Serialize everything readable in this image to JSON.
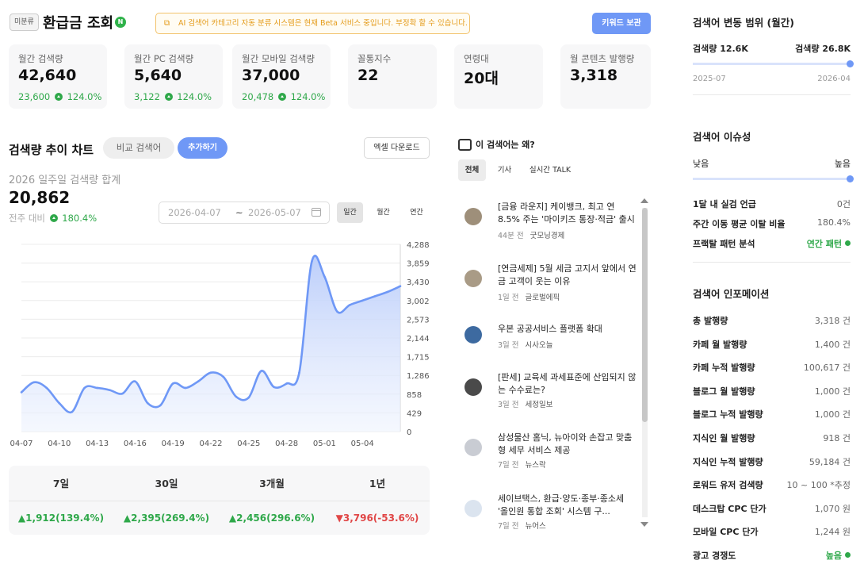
{
  "header": {
    "tag": "미분류",
    "title": "환급금 조회",
    "badge": "N",
    "beta_notice": "AI 검색어 카테고리 자동 분류 시스템은 현재 Beta 서비스 중입니다. 부정확 할 수 있습니다.",
    "save_button": "키워드 보관"
  },
  "cards": [
    {
      "label": "월간 검색량",
      "value": "42,640",
      "sub_value": "23,600",
      "sub_pct": "124.0%"
    },
    {
      "label": "월간 PC 검색량",
      "value": "5,640",
      "sub_value": "3,122",
      "sub_pct": "124.0%"
    },
    {
      "label": "월간 모바일 검색량",
      "value": "37,000",
      "sub_value": "20,478",
      "sub_pct": "124.0%"
    },
    {
      "label": "꼴통지수",
      "value": "22"
    },
    {
      "label": "연령대",
      "value": "20대"
    },
    {
      "label": "월 콘텐츠 발행량",
      "value": "3,318"
    }
  ],
  "trend": {
    "title": "검색량 추이 차트",
    "compare_button": "비교 검색어",
    "add_button": "추가하기",
    "excel_button": "엑셀 다운로드",
    "summary_label": "2026 일주일 검색량 합계",
    "summary_value": "20,862",
    "wow_label": "전주 대비",
    "wow_pct": "180.4%",
    "date_from": "2026-04-07",
    "date_sep": "~",
    "date_to": "2026-05-07",
    "periods": [
      "일간",
      "월간",
      "연간"
    ]
  },
  "chart_data": {
    "type": "area",
    "color": "#6f98f6",
    "yticks": [
      "4,288",
      "3,859",
      "3,430",
      "3,002",
      "2,573",
      "2,144",
      "1,715",
      "1,286",
      "858",
      "429",
      "0"
    ],
    "ylim": [
      0,
      4288
    ],
    "xticks": [
      "04-07",
      "04-10",
      "04-13",
      "04-16",
      "04-19",
      "04-22",
      "04-25",
      "04-28",
      "05-01",
      "05-04"
    ],
    "x": [
      "04-07",
      "04-08",
      "04-09",
      "04-10",
      "04-11",
      "04-12",
      "04-13",
      "04-14",
      "04-15",
      "04-16",
      "04-17",
      "04-18",
      "04-19",
      "04-20",
      "04-21",
      "04-22",
      "04-23",
      "04-24",
      "04-25",
      "04-26",
      "04-27",
      "04-28",
      "04-29",
      "04-30",
      "05-01",
      "05-02",
      "05-03",
      "05-04",
      "05-05",
      "05-06",
      "05-07"
    ],
    "values": [
      900,
      1130,
      1000,
      650,
      450,
      1000,
      1000,
      950,
      870,
      1150,
      650,
      600,
      1100,
      1000,
      1150,
      1350,
      1250,
      800,
      780,
      1390,
      1020,
      1100,
      1350,
      3900,
      3550,
      2750,
      2900,
      3000,
      3100,
      3200,
      3330
    ]
  },
  "periods_table": {
    "headers": [
      "7일",
      "30일",
      "3개월",
      "1년"
    ],
    "values": [
      {
        "arrow": "▲",
        "text": "1,912(139.4%)",
        "dir": "up"
      },
      {
        "arrow": "▲",
        "text": "2,395(269.4%)",
        "dir": "up"
      },
      {
        "arrow": "▲",
        "text": "2,456(296.6%)",
        "dir": "up"
      },
      {
        "arrow": "▼",
        "text": "3,796(-53.6%)",
        "dir": "down"
      }
    ]
  },
  "news": {
    "title": "이 검색어는 왜?",
    "tabs": [
      "전체",
      "기사",
      "실시간 TALK"
    ],
    "items": [
      {
        "title": "[금융 라운지] 케이뱅크, 최고 연 8.5% 주는 '마이키즈 통장·적금' 출시",
        "time": "44분 전",
        "source": "굿모닝경제"
      },
      {
        "title": "[연금세제] 5월 세금 고지서 앞에서 연금 고객이 웃는 이유",
        "time": "1일 전",
        "source": "글로벌에픽"
      },
      {
        "title": "우본 공공서비스 플랫폼 확대",
        "time": "3일 전",
        "source": "시사오늘"
      },
      {
        "title": "[판세] 교육세 과세표준에 산입되지 않는 수수료는?",
        "time": "3일 전",
        "source": "세정일보"
      },
      {
        "title": "삼성물산 홈닉, 뉴아이와 손잡고 맞춤형 세무 서비스 제공",
        "time": "7일 전",
        "source": "뉴스락"
      },
      {
        "title": "세이브택스, 환급·양도·종부·종소세 '올인원 통합 조회' 시스템 구...",
        "time": "7일 전",
        "source": "뉴어스"
      }
    ]
  },
  "range": {
    "title": "검색어 변동 범위 (월간)",
    "min_label": "검색량 12.6K",
    "max_label": "검색량 26.8K",
    "from": "2025-07",
    "to": "2026-04",
    "level": 1.0
  },
  "issue": {
    "title": "검색어 이슈성",
    "low": "낮음",
    "high": "높음",
    "level": 1.0,
    "rows": [
      {
        "label": "1달 내 실검 언급",
        "value": "0건"
      },
      {
        "label": "주간 이동 평균 이탈 비율",
        "value": "180.4%"
      },
      {
        "label": "프랙탈 패턴 분석",
        "value": "연간 패턴",
        "green": true
      }
    ]
  },
  "info": {
    "title": "검색어 인포메이션",
    "rows": [
      {
        "label": "총 발행량",
        "value": "3,318 건"
      },
      {
        "label": "카페 월 발행량",
        "value": "1,400 건"
      },
      {
        "label": "카페 누적 발행량",
        "value": "100,617 건"
      },
      {
        "label": "블로그 월 발행량",
        "value": "1,000 건"
      },
      {
        "label": "블로그 누적 발행량",
        "value": "1,000 건"
      },
      {
        "label": "지식인 월 발행량",
        "value": "918 건"
      },
      {
        "label": "지식인 누적 발행량",
        "value": "59,184 건"
      },
      {
        "label": "로워드 유저 검색량",
        "value": "10 ~ 100 *추정"
      },
      {
        "label": "데스크탑 CPC 단가",
        "value": "1,070 원"
      },
      {
        "label": "모바일 CPC 단가",
        "value": "1,244 원"
      },
      {
        "label": "광고 경쟁도",
        "value": "높음",
        "green": true
      }
    ]
  }
}
